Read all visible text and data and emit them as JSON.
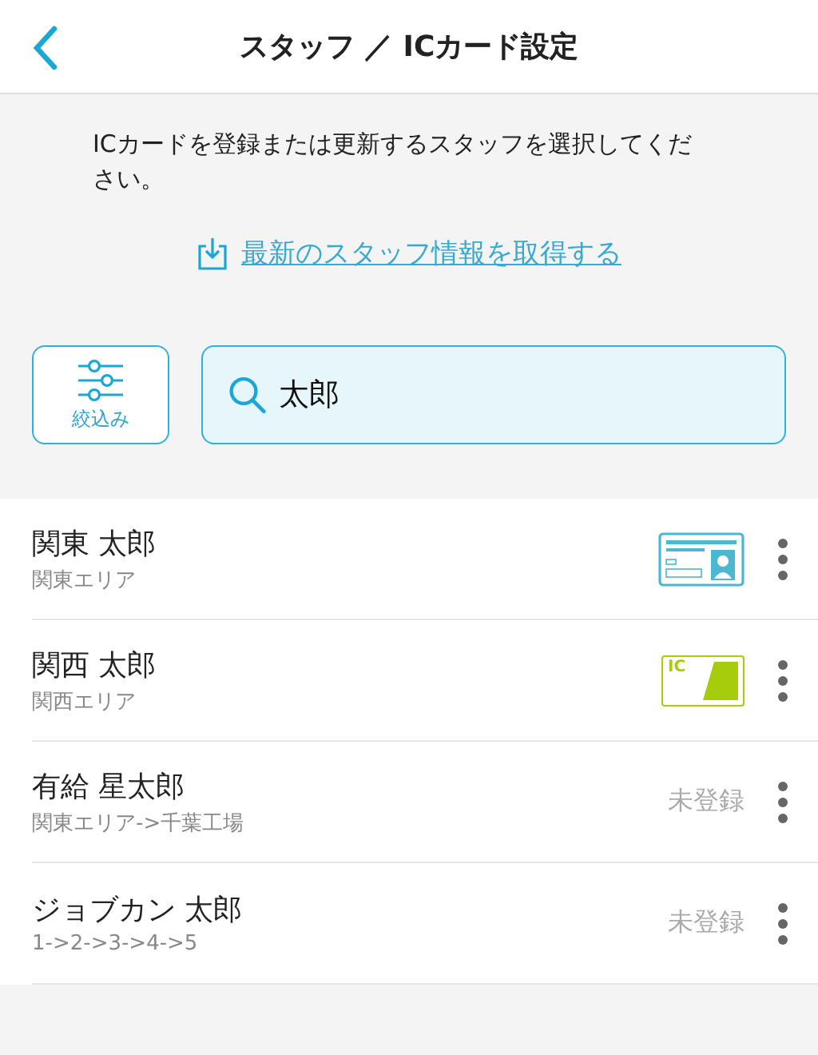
{
  "header": {
    "title": "スタッフ ／ ICカード設定"
  },
  "instruction": "ICカードを登録または更新するスタッフを選択してください。",
  "refresh_link": "最新のスタッフ情報を取得する",
  "filter_button": {
    "label": "絞込み"
  },
  "search": {
    "value": "太郎"
  },
  "staff": [
    {
      "name": "関東 太郎",
      "area": "関東エリア",
      "kind": "id_card"
    },
    {
      "name": "関西 太郎",
      "area": "関西エリア",
      "kind": "ic_card",
      "card_label": "IC"
    },
    {
      "name": "有給 星太郎",
      "area": "関東エリア->千葉工場",
      "kind": "unregistered",
      "status": "未登録"
    },
    {
      "name": "ジョブカン 太郎",
      "area": "1->2->3->4->5",
      "kind": "unregistered",
      "status": "未登録"
    }
  ]
}
